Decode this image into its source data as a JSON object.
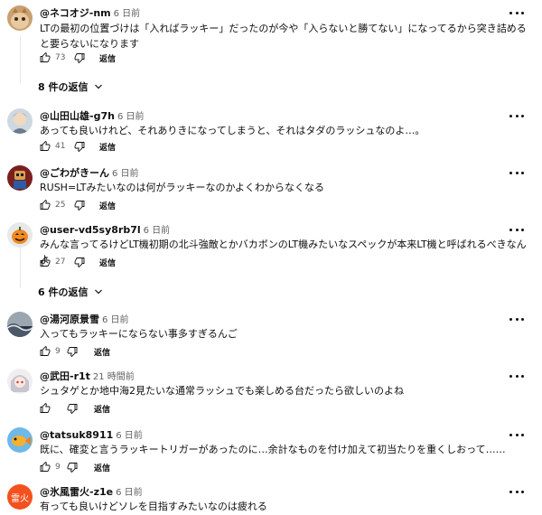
{
  "reply_label": "返信",
  "comments": [
    {
      "author": "@ネコオジ-nm",
      "time": "6 日前",
      "text": "LTの最初の位置づけは「入ればラッキー」だったのが今や「入らないと勝てない」になってるから突き詰めると要らないになります",
      "likes": "73",
      "avatar": "cat-photo",
      "replies_toggle": "8 件の返信"
    },
    {
      "author": "@山田山雄-g7h",
      "time": "6 日前",
      "text": "あっても良いけれど、それありきになってしまうと、それはタダのラッシュなのよ…。",
      "likes": "41",
      "avatar": "person-illustration"
    },
    {
      "author": "@ごわがきーん",
      "time": "6 日前",
      "text": "RUSH=LTみたいなのは何がラッキーなのかよくわからなくなる",
      "likes": "25",
      "avatar": "robot-figure"
    },
    {
      "author": "@user-vd5sy8rb7l",
      "time": "6 日前",
      "text": "みんな言ってるけどLT機初期の北斗強敵とかバカボンのLT機みたいなスペックが本来LT機と呼ばれるべきなんよ",
      "likes": "27",
      "avatar": "pumpkin",
      "replies_toggle": "6 件の返信"
    },
    {
      "author": "@湯河原景雪",
      "time": "6 日前",
      "text": "入ってもラッキーにならない事多すぎるんご",
      "likes": "9",
      "avatar": "ocean-wave"
    },
    {
      "author": "@武田-r1t",
      "time": "21 時間前",
      "text": "シュタゲとか地中海2見たいな通常ラッシュでも楽しめる台だったら欲しいのよね",
      "likes": "",
      "avatar": "anime-character"
    },
    {
      "author": "@tatsuk8911",
      "time": "6 日前",
      "text": "既に、確変と言うラッキートリガーがあったのに…余計なものを付け加えて初当たりを重くしおって……",
      "likes": "9",
      "avatar": "cartoon-fish"
    },
    {
      "author": "@氷風雷火-z1e",
      "time": "6 日前",
      "text": "有っても良いけどソレを目指すみたいなのは疲れる",
      "likes": "",
      "avatar": "text-avatar",
      "avatar_text": "雷火"
    }
  ],
  "colors": {
    "text": "#0f0f0f",
    "secondary": "#606060",
    "avatar_orange": "#f4511e"
  }
}
